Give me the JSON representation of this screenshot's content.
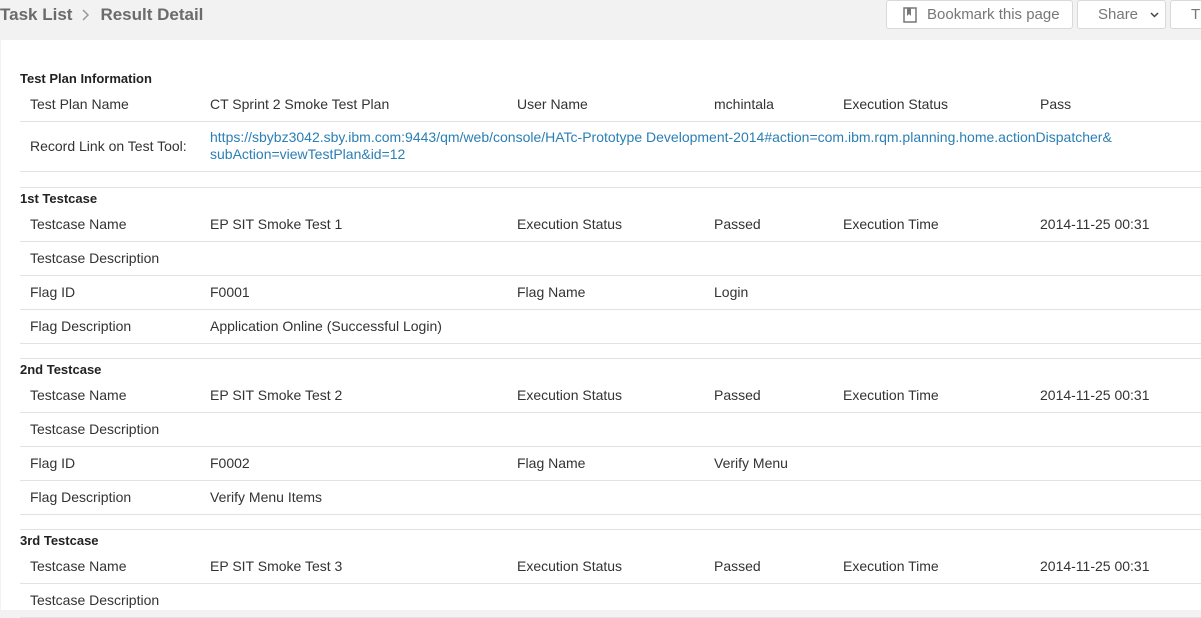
{
  "breadcrumb": {
    "parent": "Task List",
    "current": "Result Detail"
  },
  "toolbar": {
    "bookmark_label": "Bookmark this page",
    "share_label": "Share",
    "more_label": "T"
  },
  "plan": {
    "section_title": "Test Plan Information",
    "name_label": "Test Plan Name",
    "name_value": "CT Sprint 2 Smoke Test Plan",
    "user_label": "User Name",
    "user_value": "mchintala",
    "status_label": "Execution Status",
    "status_value": "Pass",
    "record_label": "Record Link on Test Tool:",
    "record_link": "https://sbybz3042.sby.ibm.com:9443/qm/web/console/HATc-Prototype Development-2014#action=com.ibm.rqm.planning.home.actionDispatcher& subAction=viewTestPlan&id=12"
  },
  "testcases": [
    {
      "title": "1st Testcase",
      "name_label": "Testcase Name",
      "name_value": "EP SIT Smoke Test 1",
      "status_label": "Execution Status",
      "status_value": "Passed",
      "time_label": "Execution Time",
      "time_value": "2014-11-25 00:31",
      "desc_label": "Testcase Description",
      "flag_id_label": "Flag ID",
      "flag_id_value": "F0001",
      "flag_name_label": "Flag Name",
      "flag_name_value": "Login",
      "flag_desc_label": "Flag Description",
      "flag_desc_value": "Application Online (Successful Login)"
    },
    {
      "title": "2nd Testcase",
      "name_label": "Testcase Name",
      "name_value": "EP SIT Smoke Test 2",
      "status_label": "Execution Status",
      "status_value": "Passed",
      "time_label": "Execution Time",
      "time_value": "2014-11-25 00:31",
      "desc_label": "Testcase Description",
      "flag_id_label": "Flag ID",
      "flag_id_value": "F0002",
      "flag_name_label": "Flag Name",
      "flag_name_value": "Verify Menu",
      "flag_desc_label": "Flag Description",
      "flag_desc_value": "Verify Menu Items"
    },
    {
      "title": "3rd Testcase",
      "name_label": "Testcase Name",
      "name_value": "EP SIT Smoke Test 3",
      "status_label": "Execution Status",
      "status_value": "Passed",
      "time_label": "Execution Time",
      "time_value": "2014-11-25 00:31",
      "desc_label": "Testcase Description"
    }
  ],
  "colors": {
    "link": "#2a7fb5",
    "breadcrumb": "#6b6b6b"
  },
  "icons": {
    "bookmark": "bookmark-icon",
    "separator": "chevron-right-icon",
    "share": "chevron-down-icon"
  }
}
